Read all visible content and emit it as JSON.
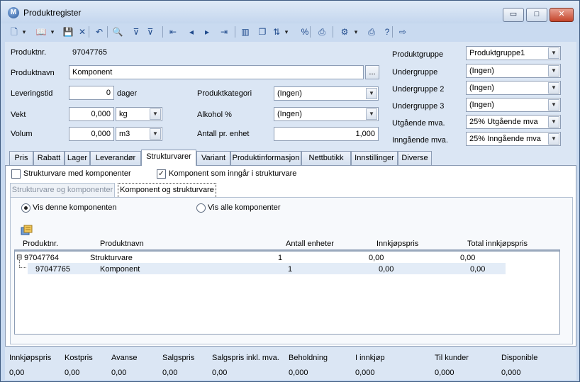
{
  "window": {
    "title": "Produktregister",
    "app_icon": "M",
    "minimize": "▭",
    "maximize": "□",
    "close": "✕"
  },
  "toolbar": [
    {
      "name": "new-icon",
      "glyph": "🗋"
    },
    {
      "name": "new-dropdown-icon",
      "glyph": "▾"
    },
    {
      "name": "open-icon",
      "glyph": "📖"
    },
    {
      "name": "open-dropdown-icon",
      "glyph": "▾"
    },
    {
      "name": "save-icon",
      "glyph": "💾"
    },
    {
      "name": "delete-icon",
      "glyph": "✕"
    },
    {
      "name": "undo-icon",
      "glyph": "↶"
    },
    {
      "name": "search-icon",
      "glyph": "🔍"
    },
    {
      "name": "filter-icon",
      "glyph": "⊽"
    },
    {
      "name": "clear-filter-icon",
      "glyph": "⊽"
    },
    {
      "name": "first-icon",
      "glyph": "⇤"
    },
    {
      "name": "previous-icon",
      "glyph": "◂"
    },
    {
      "name": "next-icon",
      "glyph": "▸"
    },
    {
      "name": "last-icon",
      "glyph": "⇥"
    },
    {
      "name": "chart-icon",
      "glyph": "▥"
    },
    {
      "name": "copy-icon",
      "glyph": "❐"
    },
    {
      "name": "sort-icon",
      "glyph": "⇅"
    },
    {
      "name": "sort-dropdown-icon",
      "glyph": "▾"
    },
    {
      "name": "percent-icon",
      "glyph": "%"
    },
    {
      "name": "print-preview-icon",
      "glyph": "⎙"
    },
    {
      "name": "properties-icon",
      "glyph": "⚙"
    },
    {
      "name": "properties-dropdown-icon",
      "glyph": "▾"
    },
    {
      "name": "print-icon",
      "glyph": "⎙"
    },
    {
      "name": "help-icon",
      "glyph": "?"
    },
    {
      "name": "exit-icon",
      "glyph": "⇨"
    }
  ],
  "product": {
    "nr_label": "Produktnr.",
    "nr_value": "97047765",
    "name_label": "Produktnavn",
    "name_value": "Komponent",
    "browse_btn": "...",
    "delivery_label": "Leveringstid",
    "delivery_value": "0",
    "delivery_unit": "dager",
    "weight_label": "Vekt",
    "weight_value": "0,000",
    "weight_unit": "kg",
    "volume_label": "Volum",
    "volume_value": "0,000",
    "volume_unit": "m3",
    "category_label": "Produktkategori",
    "category_value": "(Ingen)",
    "alcohol_label": "Alkohol %",
    "alcohol_value": "(Ingen)",
    "units_label": "Antall pr. enhet",
    "units_value": "1,000"
  },
  "groups": {
    "group_label": "Produktgruppe",
    "group_value": "Produktgruppe1",
    "sub1_label": "Undergruppe",
    "sub1_value": "(Ingen)",
    "sub2_label": "Undergruppe 2",
    "sub2_value": "(Ingen)",
    "sub3_label": "Undergruppe 3",
    "sub3_value": "(Ingen)",
    "vat_out_label": "Utgående mva.",
    "vat_out_value": "25%  Utgående mva",
    "vat_in_label": "Inngående mva.",
    "vat_in_value": "25% Inngående mva"
  },
  "tabs": [
    "Pris",
    "Rabatt",
    "Lager",
    "Leverandør",
    "Strukturvarer",
    "Variant",
    "Produktinformasjon",
    "Nettbutikk",
    "Innstillinger",
    "Diverse"
  ],
  "structure": {
    "chk_struct_label": "Strukturvare med komponenter",
    "chk_comp_label": "Komponent som inngår i strukturvare",
    "chk_comp_mark": "✓",
    "subtab1": "Strukturvare og komponenter",
    "subtab2": "Komponent og strukturvare",
    "radio1": "Vis denne komponenten",
    "radio2": "Vis alle komponenter",
    "columns": {
      "nr": "Produktnr.",
      "name": "Produktnavn",
      "qty": "Antall enheter",
      "price": "Innkjøpspris",
      "total": "Total innkjøpspris"
    },
    "rows": [
      {
        "expander": "⊟",
        "nr": "97047764",
        "name": "Strukturvare",
        "qty": "1",
        "price": "0,00",
        "total": "0,00"
      },
      {
        "nr": "97047765",
        "name": "Komponent",
        "qty": "1",
        "price": "0,00",
        "total": "0,00"
      }
    ]
  },
  "footer": [
    {
      "label": "Innkjøpspris",
      "value": "0,00"
    },
    {
      "label": "Kostpris",
      "value": "0,00"
    },
    {
      "label": "Avanse",
      "value": "0,00"
    },
    {
      "label": "Salgspris",
      "value": "0,00"
    },
    {
      "label": "Salgspris inkl. mva.",
      "value": "0,00"
    },
    {
      "label": "Beholdning",
      "value": "0,000"
    },
    {
      "label": "I innkjøp",
      "value": "0,000"
    },
    {
      "label": "Til kunder",
      "value": "0,000"
    },
    {
      "label": "Disponible",
      "value": "0,000"
    }
  ],
  "colors": {
    "window_bg": "#c9daf0",
    "content_bg": "#dbe6f4",
    "selected_row": "#e3ecf7"
  }
}
